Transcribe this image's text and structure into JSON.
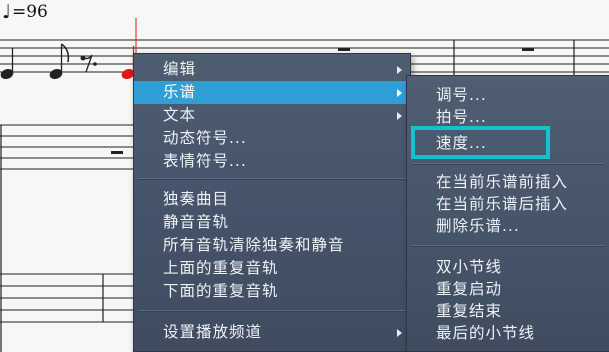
{
  "score": {
    "tempo_value": "=96"
  },
  "context_menu": {
    "items": [
      {
        "label": "编辑",
        "submenu": true
      },
      {
        "label": "乐谱",
        "submenu": true,
        "active": true
      },
      {
        "label": "文本",
        "submenu": true
      },
      {
        "label": "动态符号..."
      },
      {
        "label": "表情符号..."
      },
      {
        "label": "独奏曲目"
      },
      {
        "label": "静音音轨"
      },
      {
        "label": "所有音轨清除独奏和静音"
      },
      {
        "label": "上面的重复音轨"
      },
      {
        "label": "下面的重复音轨"
      },
      {
        "label": "设置播放频道",
        "submenu": true
      }
    ]
  },
  "submenu": {
    "items": [
      {
        "label": "调号..."
      },
      {
        "label": "拍号..."
      },
      {
        "label": "速度..."
      },
      {
        "label": "在当前乐谱前插入"
      },
      {
        "label": "在当前乐谱后插入"
      },
      {
        "label": "删除乐谱..."
      },
      {
        "label": "双小节线"
      },
      {
        "label": "重复启动"
      },
      {
        "label": "重复结束"
      },
      {
        "label": "最后的小节线"
      }
    ]
  },
  "colors": {
    "menu_bg": "#46546a",
    "active_item": "#2f9fd6",
    "annotation_box": "#14c3c9",
    "cursor_note": "#e01818"
  }
}
